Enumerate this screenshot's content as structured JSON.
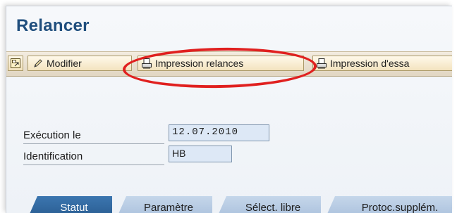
{
  "window": {
    "title": "Relancer"
  },
  "toolbar": {
    "expand_icon": "expand-window-icon",
    "modifier_label": "Modifier",
    "modifier_icon": "pencil-icon",
    "impression_relances_label": "Impression relances",
    "impression_relances_icon": "print-icon",
    "impression_essai_label": "Impression d'essa",
    "impression_essai_icon": "print-icon"
  },
  "form": {
    "execution_label": "Exécution le",
    "execution_value": "12.07.2010",
    "identification_label": "Identification",
    "identification_value": "HB"
  },
  "tabs": [
    {
      "label": "Statut",
      "active": true
    },
    {
      "label": "Paramètre",
      "active": false
    },
    {
      "label": "Sélect. libre",
      "active": false
    },
    {
      "label": "Protoc.supplém.",
      "active": false
    }
  ],
  "colors": {
    "title": "#1f4e7d",
    "highlight_ring": "#e0201f",
    "active_tab": "#285b8f",
    "input_bg": "#dde8f6"
  }
}
